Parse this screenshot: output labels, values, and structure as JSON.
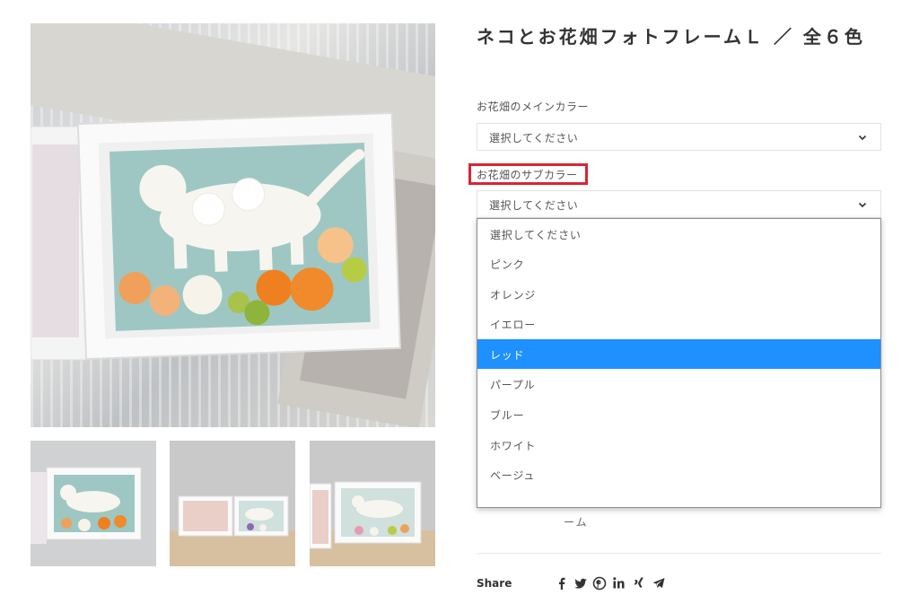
{
  "product": {
    "title": "ネコとお花畑フォトフレームＬ ／ 全６色"
  },
  "options": {
    "main_color": {
      "label": "お花畑のメインカラー",
      "value": "選択してください"
    },
    "sub_color": {
      "label": "お花畑のサブカラー",
      "value": "選択してください"
    }
  },
  "dropdown": {
    "items": [
      {
        "label": "選択してください",
        "selected": false
      },
      {
        "label": "ピンク",
        "selected": false
      },
      {
        "label": "オレンジ",
        "selected": false
      },
      {
        "label": "イエロー",
        "selected": false
      },
      {
        "label": "レッド",
        "selected": true
      },
      {
        "label": "パープル",
        "selected": false
      },
      {
        "label": "ブルー",
        "selected": false
      },
      {
        "label": "ホワイト",
        "selected": false
      },
      {
        "label": "ベージュ",
        "selected": false
      }
    ]
  },
  "description": {
    "partial_text": "ーム"
  },
  "share": {
    "label": "Share",
    "icons": [
      "facebook-icon",
      "twitter-icon",
      "pinterest-icon",
      "linkedin-icon",
      "xing-icon",
      "telegram-icon"
    ]
  },
  "colors": {
    "highlight": "#d92533",
    "selected_option": "#1e90ff"
  }
}
